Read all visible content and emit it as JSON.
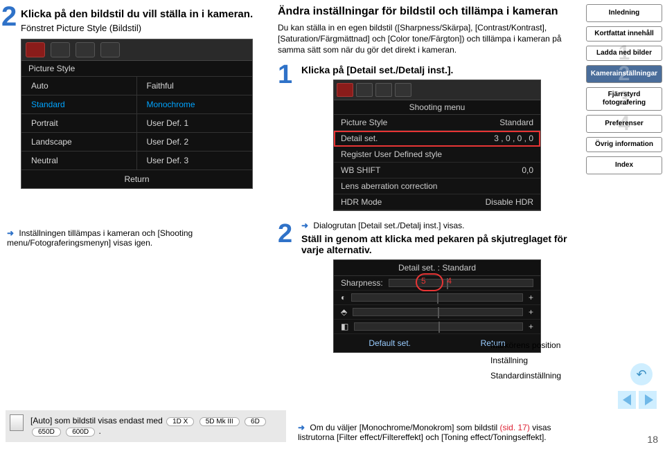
{
  "page_number": "18",
  "left": {
    "title": "Klicka på den bildstil du vill ställa in i kameran.",
    "subtitle": "Fönstret Picture Style (Bildstil)"
  },
  "ps_window": {
    "title": "Picture Style",
    "auto": "Auto",
    "faithful": "Faithful",
    "standard": "Standard",
    "monochrome": "Monochrome",
    "portrait": "Portrait",
    "ud1": "User Def. 1",
    "landscape": "Landscape",
    "ud2": "User Def. 2",
    "neutral": "Neutral",
    "ud3": "User Def. 3",
    "return": "Return"
  },
  "left_note": "Inställningen tillämpas i kameran och [Shooting menu/Fotograferingsmenyn] visas igen.",
  "right": {
    "heading": "Ändra inställningar för bildstil och tillämpa i kameran",
    "body": "Du kan ställa in en egen bildstil ([Sharpness/Skärpa], [Contrast/Kontrast], [Saturation/Färgmättnad] och [Color tone/Färgton]) och tillämpa i kameran på samma sätt som när du gör det direkt i kameran.",
    "step1": "Klicka på [Detail set./Detalj inst.].",
    "step2_arrow": "Dialogrutan [Detail set./Detalj inst.] visas.",
    "step2": "Ställ in genom att klicka med pekaren på skjutreglaget för varje alternativ."
  },
  "shoot": {
    "title": "Shooting menu",
    "r1a": "Picture Style",
    "r1b": "Standard",
    "r2a": "Detail set.",
    "r2b": "3 , 0 , 0 , 0",
    "r3a": "Register User Defined style",
    "r3b": "",
    "r4a": "WB SHIFT",
    "r4b": "0,0",
    "r5a": "Lens aberration correction",
    "r5b": "",
    "r6a": "HDR Mode",
    "r6b": "Disable HDR"
  },
  "detail": {
    "title": "Detail set. : Standard",
    "sharpness": "Sharpness:",
    "default": "Default set.",
    "ret": "Return",
    "callouts": {
      "pos": "Markörens position",
      "set": "Inställning",
      "std": "Standardinställning"
    },
    "redloop_left": "5",
    "redloop_right": "4"
  },
  "sidebar": {
    "intro": "Inledning",
    "summary": "Kortfattat innehåll",
    "s1": "Ladda ned bilder",
    "s2": "Kamerainställningar",
    "s3": "Fjärrstyrd fotografering",
    "s4": "Preferenser",
    "other": "Övrig information",
    "index": "Index"
  },
  "bottom_left": {
    "text_a": "[Auto] som bildstil visas endast med",
    "chips": [
      "1D X",
      "5D Mk III",
      "6D",
      "650D",
      "600D"
    ],
    "dot": "."
  },
  "bottom_right": {
    "text_a": "Om du väljer [Monochrome/Monokrom] som bildstil ",
    "sidref": "(sid. 17)",
    "text_b": " visas listrutorna [Filter effect/Filtereffekt] och [Toning effect/Toningseffekt]."
  }
}
